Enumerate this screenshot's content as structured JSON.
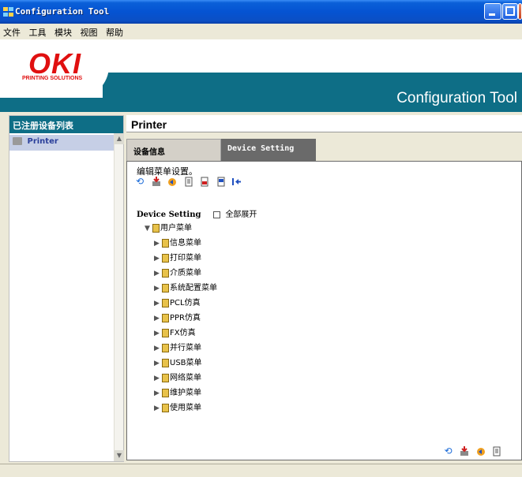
{
  "window": {
    "title": "Configuration Tool"
  },
  "menu": {
    "items": [
      "文件",
      "工具",
      "模块",
      "视图",
      "帮助"
    ]
  },
  "banner": {
    "logo": "OKI",
    "logo_sub": "PRINTING SOLUTIONS",
    "app_title": "Configuration Tool"
  },
  "left_panel": {
    "header": "已注册设备列表",
    "items": [
      {
        "label": "Printer"
      }
    ]
  },
  "main": {
    "title": "Printer",
    "tabs": [
      {
        "label": "设备信息"
      },
      {
        "label": "Device Setting"
      }
    ],
    "description": "编辑菜单设置。",
    "tree": {
      "header": "Device Setting",
      "expand_all_label": "全部展开",
      "root": "用户菜单",
      "children": [
        "信息菜单",
        "打印菜单",
        "介质菜单",
        "系统配置菜单",
        "PCL仿真",
        "PPR仿真",
        "FX仿真",
        "并行菜单",
        "USB菜单",
        "网络菜单",
        "维护菜单",
        "使用菜单"
      ]
    }
  },
  "colors": {
    "banner_band": "#0e6e86",
    "logo_red": "#e01010",
    "titlebar_blue": "#0553d2"
  }
}
